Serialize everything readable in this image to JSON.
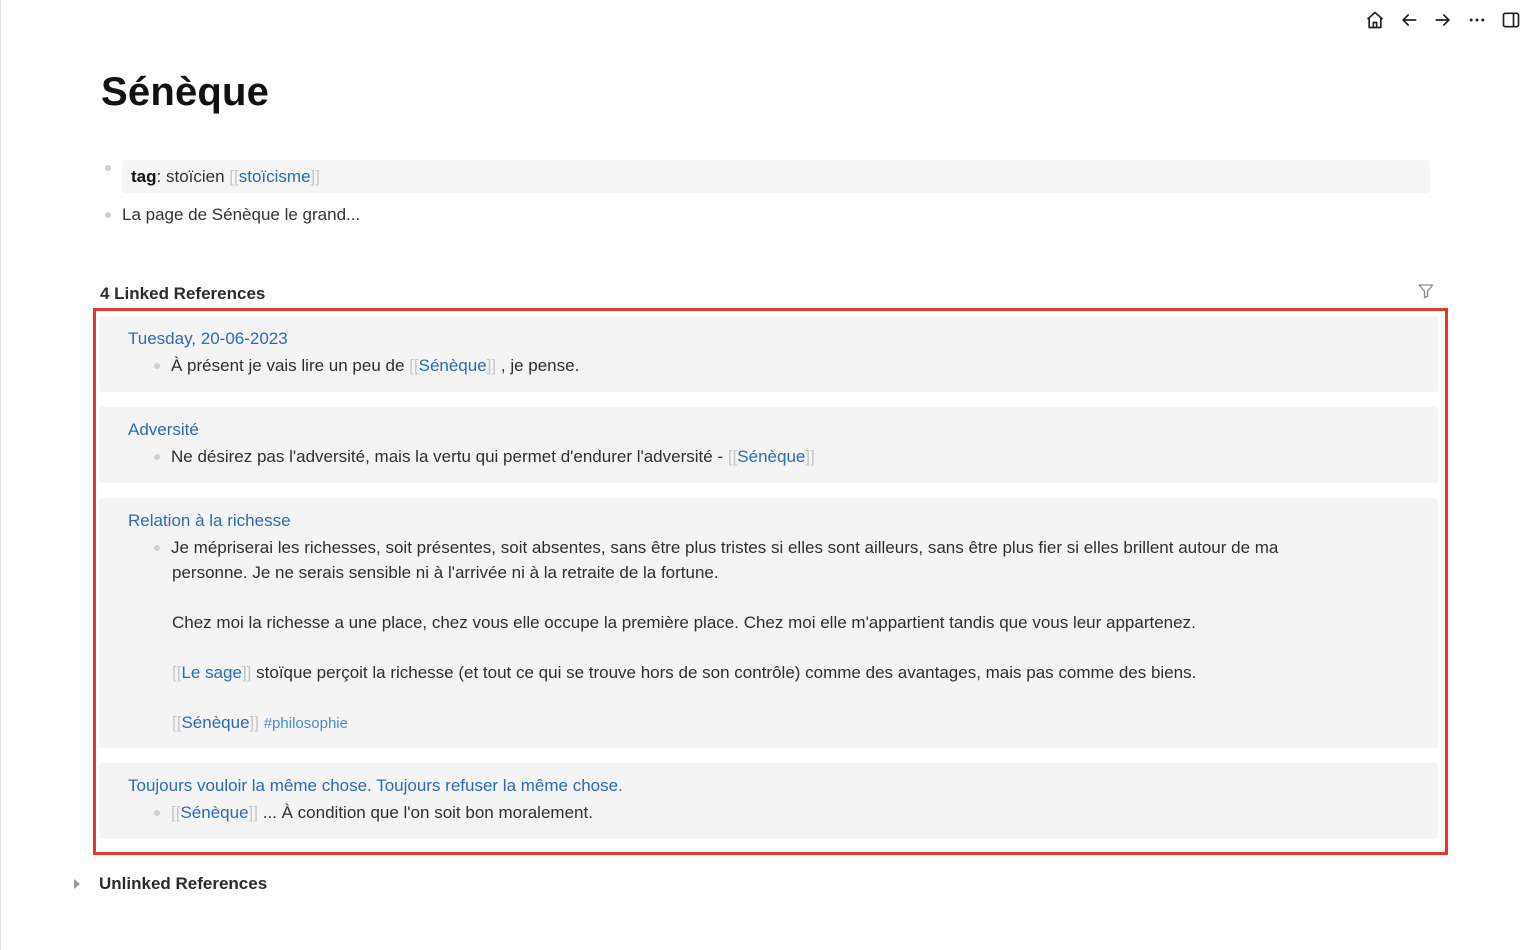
{
  "page": {
    "title": "Sénèque"
  },
  "properties": {
    "key": "tag",
    "colon": ":",
    "value": "stoïcien",
    "link_open": "[[",
    "link": "stoïcisme",
    "link_close": "]]"
  },
  "description": {
    "text": "La page de Sénèque le grand..."
  },
  "linked_references": {
    "header": "4 Linked References",
    "cards": [
      {
        "title": "Tuesday, 20-06-2023",
        "text_before": "À présent je vais lire un peu de",
        "link": "Sénèque",
        "text_after": ", je pense."
      },
      {
        "title": "Adversité",
        "text_before": "Ne désirez pas l'adversité, mais la vertu qui permet d'endurer l'adversité -",
        "link": "Sénèque"
      },
      {
        "title": "Relation à la richesse",
        "line1": "Je mépriserai les richesses, soit présentes, soit absentes, sans être plus tristes si elles sont ailleurs, sans être plus fier si elles brillent autour de ma",
        "line2": "personne. Je ne serais sensible ni à l'arrivée ni à la retraite de la fortune.",
        "line3": "Chez moi la richesse a une place, chez vous elle occupe la première place. Chez moi elle m'appartient tandis que vous leur appartenez.",
        "line4_link": "Le sage",
        "line4_text": "stoïque perçoit la richesse (et tout ce qui se trouve hors de son contrôle) comme des avantages, mais pas comme des biens.",
        "line5_link": "Sénèque",
        "line5_tag": "#philosophie"
      },
      {
        "title": "Toujours vouloir la même chose. Toujours refuser la même chose.",
        "link": "Sénèque",
        "text_after": "... À condition que l'on soit bon moralement."
      }
    ]
  },
  "unlinked_references": {
    "header": "Unlinked References"
  },
  "brackets": {
    "open": "[[",
    "close": "]]"
  },
  "icons": [
    "home-icon",
    "arrow-left-icon",
    "arrow-right-icon",
    "more-icon",
    "sidebar-toggle-icon",
    "filter-icon"
  ],
  "colors": {
    "link": "#2a6bb3",
    "highlight": "#e0392b",
    "card_bg": "#f4f4f4"
  }
}
